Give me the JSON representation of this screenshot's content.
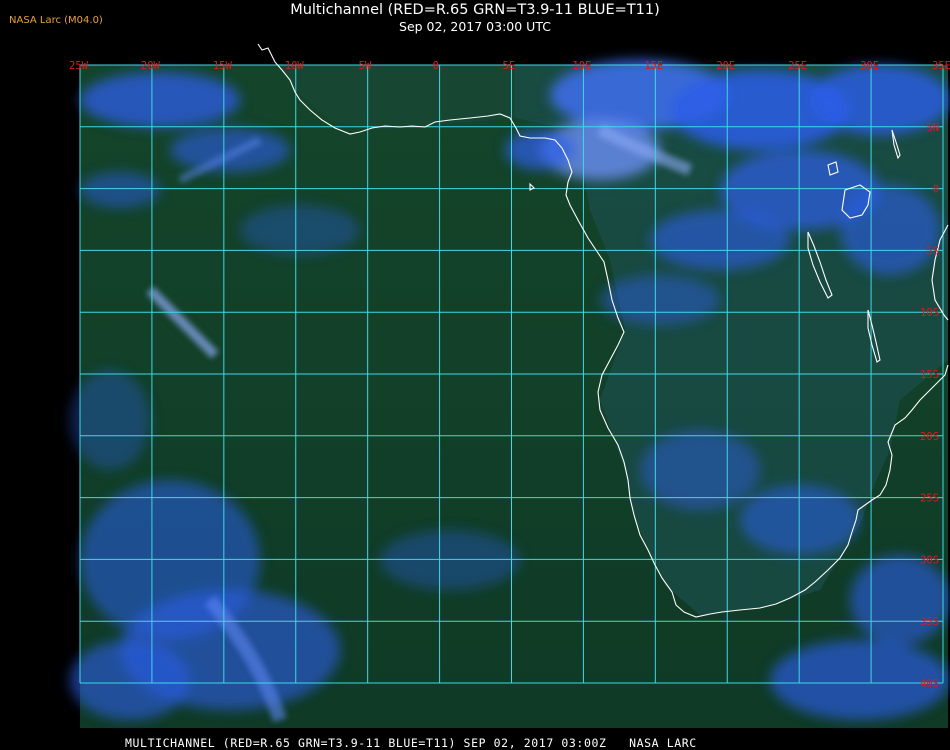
{
  "credit": "NASA Larc (M04.0)",
  "title": {
    "line1": "Multichannel (RED=R.65 GRN=T3.9-11 BLUE=T11)",
    "line2": "Sep 02, 2017 03:00 UTC"
  },
  "footer": "MULTICHANNEL (RED=R.65 GRN=T3.9-11 BLUE=T11) SEP 02, 2017 03:00Z   NASA LARC",
  "map": {
    "lon_labels": [
      "25W",
      "20W",
      "15W",
      "10W",
      "5W",
      "0",
      "5E",
      "10E",
      "15E",
      "20E",
      "25E",
      "30E",
      "35E"
    ],
    "lat_labels": [
      "5N",
      "0",
      "5S",
      "10S",
      "15S",
      "20S",
      "25S",
      "30S",
      "35S",
      "40S"
    ],
    "colors": {
      "ocean": "#14452a",
      "cloud_blue": "#2c5ee8",
      "cloud_light": "#6b8ff5",
      "grid": "#3fd9e6",
      "coast": "#ffffff",
      "label": "#e01818",
      "credit": "#e8a23a"
    }
  }
}
